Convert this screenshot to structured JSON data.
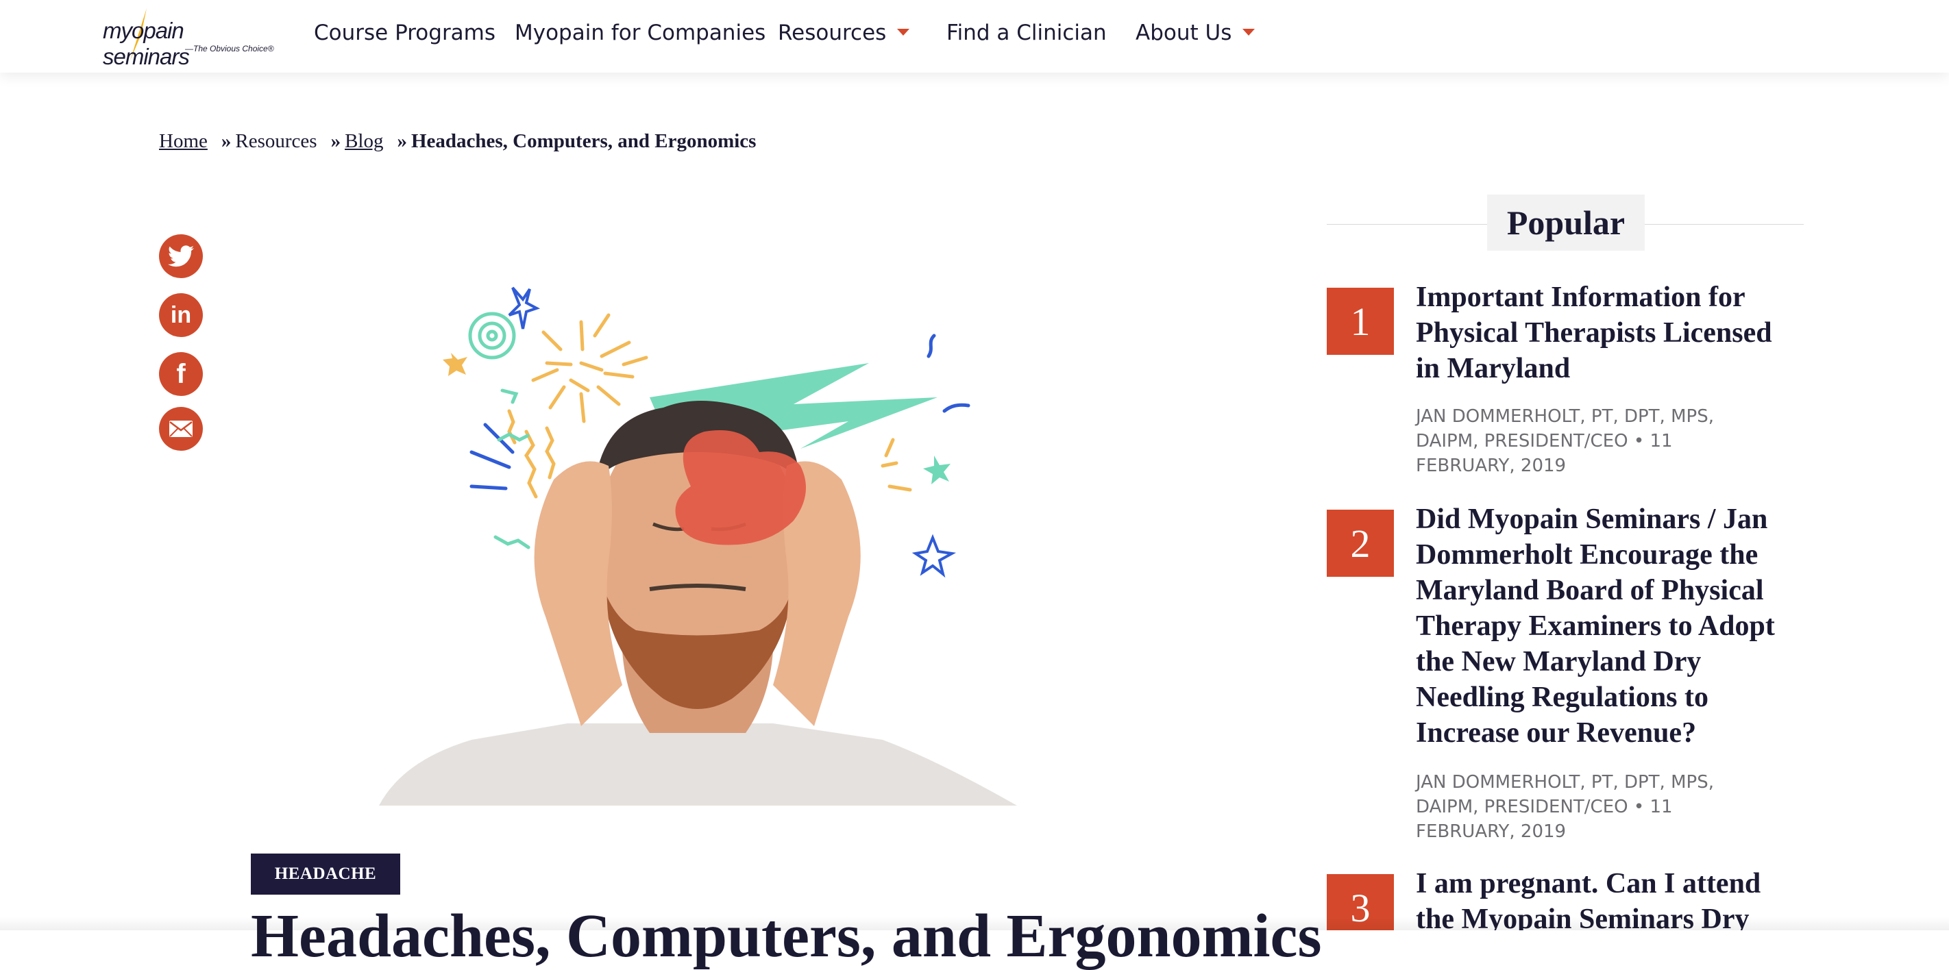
{
  "logo": {
    "text": "myopain seminars",
    "tagline": "—The Obvious Choice®"
  },
  "nav": [
    {
      "label": "Course Programs",
      "dropdown": false
    },
    {
      "label": "Myopain for Companies",
      "dropdown": false
    },
    {
      "label": "Resources",
      "dropdown": true
    },
    {
      "label": "Find a Clinician",
      "dropdown": false
    },
    {
      "label": "About Us",
      "dropdown": true
    }
  ],
  "breadcrumb": {
    "home": "Home",
    "sep": "»",
    "resources": "Resources",
    "blog": "Blog",
    "current": "Headaches, Computers, and Ergonomics"
  },
  "social": {
    "twitter": "twitter-icon",
    "linkedin": "in",
    "facebook": "f",
    "email": "email-icon"
  },
  "article": {
    "category": "HEADACHE",
    "title": "Headaches, Computers, and Ergonomics"
  },
  "sidebar": {
    "heading": "Popular",
    "items": [
      {
        "num": "1",
        "title": "Important Information for Physical Therapists Licensed in Maryland",
        "meta": "JAN DOMMERHOLT, PT, DPT, MPS, DAIPM, PRESIDENT/CEO • 11 FEBRUARY, 2019"
      },
      {
        "num": "2",
        "title": "Did Myopain Seminars / Jan Dommerholt Encourage the Maryland Board of Physical Therapy Examiners to Adopt the New Maryland Dry Needling Regulations to Increase our Revenue?",
        "meta": "JAN DOMMERHOLT, PT, DPT, MPS, DAIPM, PRESIDENT/CEO • 11 FEBRUARY, 2019"
      },
      {
        "num": "3",
        "title": "I am pregnant. Can I attend the Myopain Seminars Dry",
        "meta": ""
      }
    ]
  },
  "colors": {
    "accent": "#d5482b",
    "navy": "#1e1a3c",
    "text": "#1b1a33"
  }
}
